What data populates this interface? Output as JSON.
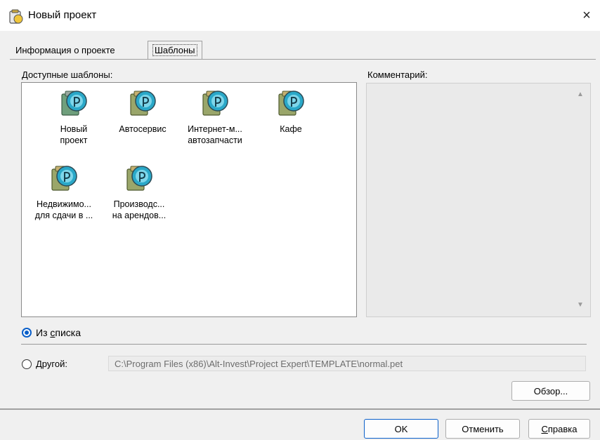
{
  "window": {
    "title": "Новый проект",
    "close_label": "×"
  },
  "tabs": {
    "info": "Информация о проекте",
    "templates": "Шаблоны"
  },
  "available_label": "Доступные шаблоны:",
  "comment_label": "Комментарий:",
  "templates": [
    {
      "line1": "Новый",
      "line2": "проект"
    },
    {
      "line1": "Автосервис",
      "line2": ""
    },
    {
      "line1": "Интернет-м...",
      "line2": "автозапчасти"
    },
    {
      "line1": "Кафе",
      "line2": ""
    },
    {
      "line1": "Недвижимо...",
      "line2": "для сдачи в ..."
    },
    {
      "line1": "Производс...",
      "line2": "на арендов..."
    }
  ],
  "source": {
    "from_list": {
      "prefix": "Из ",
      "accel": "с",
      "rest": "писка"
    },
    "other_label": "Другой:",
    "path": "C:\\Program Files (x86)\\Alt-Invest\\Project Expert\\TEMPLATE\\normal.pet"
  },
  "buttons": {
    "browse": "Обзор...",
    "ok": "OK",
    "cancel": "Отменить",
    "help_accel": "С",
    "help_rest": "правка"
  },
  "colors": {
    "accent": "#0a5fc9",
    "icon_teal": "#2aa8c8",
    "icon_body": "#5a8c6a"
  }
}
